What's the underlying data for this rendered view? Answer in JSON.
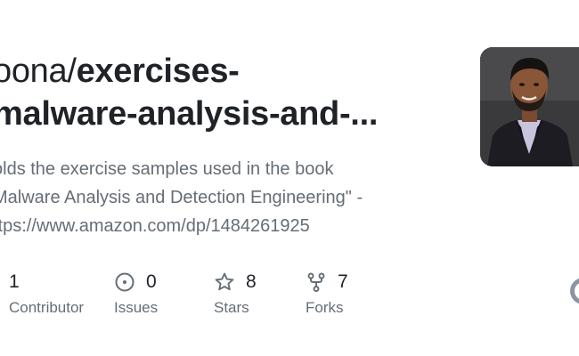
{
  "repo": {
    "owner": "oona/",
    "name_line1": "exercises-",
    "name_line2": "malware-analysis-and-..."
  },
  "description": {
    "line1": "olds the exercise samples used in the book",
    "line2": "Malware Analysis and Detection Engineering\" -",
    "line3": "ttps://www.amazon.com/dp/1484261925"
  },
  "stats": {
    "contributors": {
      "count": "1",
      "label": "Contributor",
      "icon": "people-icon"
    },
    "issues": {
      "count": "0",
      "label": "Issues",
      "icon": "issue-opened-icon"
    },
    "stars": {
      "count": "8",
      "label": "Stars",
      "icon": "star-icon"
    },
    "forks": {
      "count": "7",
      "label": "Forks",
      "icon": "repo-forked-icon"
    }
  },
  "colors": {
    "text_primary": "#1f2328",
    "text_secondary": "#656d76",
    "icon": "#656d76"
  }
}
